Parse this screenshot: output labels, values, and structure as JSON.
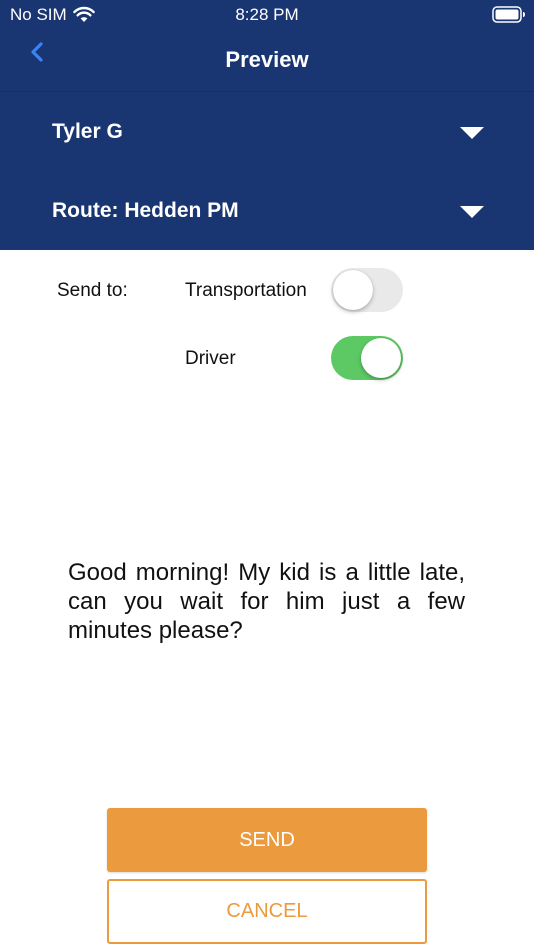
{
  "status_bar": {
    "carrier": "No SIM",
    "time": "8:28 PM",
    "icons": [
      "wifi-icon",
      "battery-icon"
    ]
  },
  "nav": {
    "back_icon": "chevron-left-icon",
    "title": "Preview"
  },
  "selectors": {
    "person": "Tyler G",
    "route": "Route: Hedden PM",
    "dropdown_icon": "triangle-down-icon"
  },
  "send_to": {
    "label": "Send to:",
    "options": [
      {
        "label": "Transportation",
        "enabled": false
      },
      {
        "label": "Driver",
        "enabled": true
      }
    ]
  },
  "message": "Good morning! My kid is a little late, can you wait for him just a few minutes please?",
  "actions": {
    "send_label": "SEND",
    "cancel_label": "CANCEL"
  },
  "colors": {
    "header_bg": "#1a3672",
    "accent_orange": "#eb9a3e",
    "toggle_on": "#5cc964",
    "toggle_off": "#e9e9ea",
    "back_icon": "#3b82f6"
  }
}
